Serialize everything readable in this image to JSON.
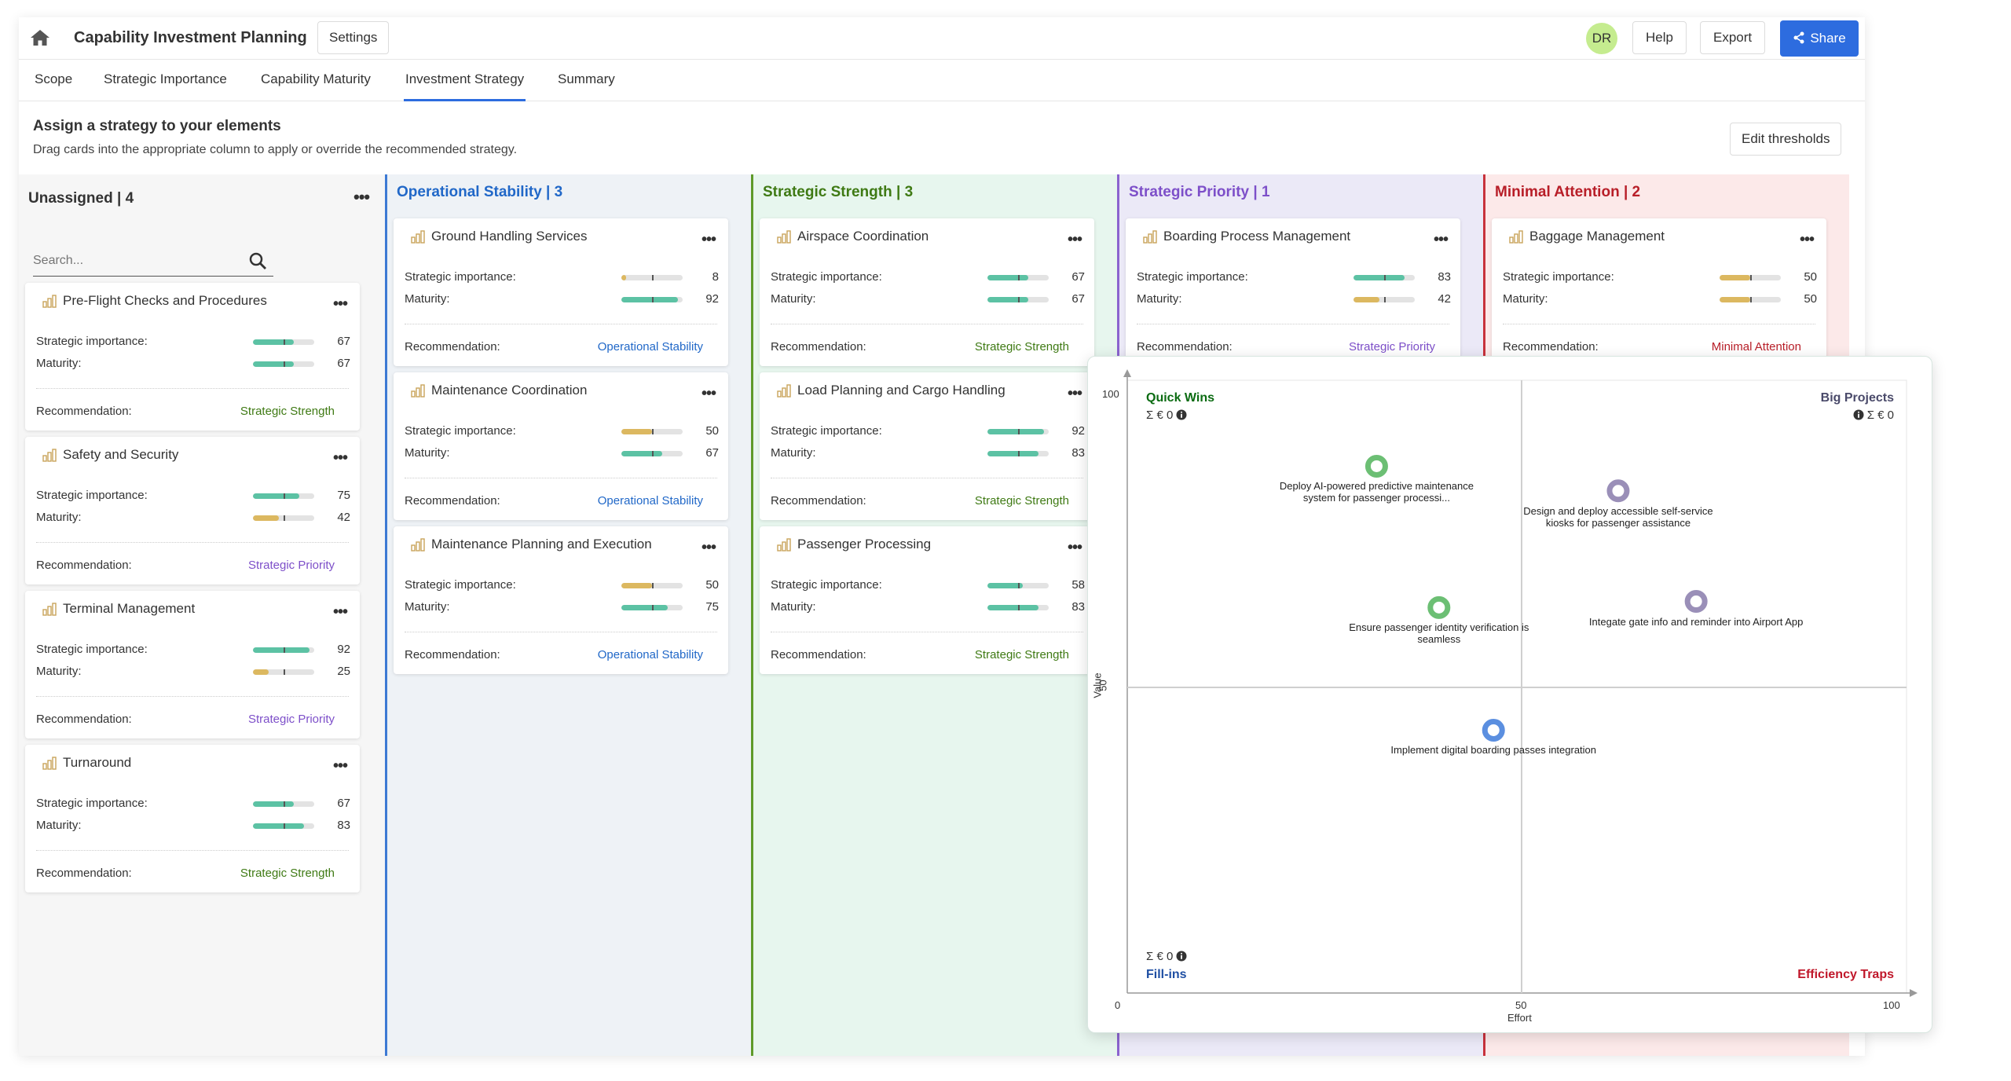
{
  "header": {
    "title": "Capability Investment Planning",
    "settings_label": "Settings",
    "avatar_initials": "DR",
    "help_label": "Help",
    "export_label": "Export",
    "share_label": "Share"
  },
  "tabs": [
    {
      "label": "Scope"
    },
    {
      "label": "Strategic Importance"
    },
    {
      "label": "Capability Maturity"
    },
    {
      "label": "Investment Strategy",
      "active": true
    },
    {
      "label": "Summary"
    }
  ],
  "intro": {
    "title": "Assign a strategy to your elements",
    "subtitle": "Drag cards into the appropriate column to apply or override the recommended strategy.",
    "edit_thresholds_label": "Edit thresholds"
  },
  "card_labels": {
    "importance": "Strategic importance:",
    "maturity": "Maturity:",
    "recommendation": "Recommendation:"
  },
  "colors": {
    "high": "#5cc2a4",
    "low": "#dcb860",
    "operational": "#2168c8",
    "strategic_strength": "#3f7a14",
    "strategic_priority": "#7d4fc9",
    "minimal_attention": "#b81e28"
  },
  "columns": {
    "unassigned": {
      "header": "Unassigned | 4",
      "search_placeholder": "Search...",
      "cards": [
        {
          "title": "Pre-Flight Checks and Procedures",
          "importance": 67,
          "maturity": 67,
          "recommendation": "Strategic Strength"
        },
        {
          "title": "Safety and Security",
          "importance": 75,
          "maturity": 42,
          "recommendation": "Strategic Priority"
        },
        {
          "title": "Terminal Management",
          "importance": 92,
          "maturity": 25,
          "recommendation": "Strategic Priority"
        },
        {
          "title": "Turnaround",
          "importance": 67,
          "maturity": 83,
          "recommendation": "Strategic Strength"
        }
      ]
    },
    "operational": {
      "header": "Operational Stability | 3",
      "cards": [
        {
          "title": "Ground Handling Services",
          "importance": 8,
          "maturity": 92,
          "recommendation": "Operational Stability"
        },
        {
          "title": "Maintenance Coordination",
          "importance": 50,
          "maturity": 67,
          "recommendation": "Operational Stability"
        },
        {
          "title": "Maintenance Planning and Execution",
          "importance": 50,
          "maturity": 75,
          "recommendation": "Operational Stability"
        }
      ]
    },
    "strategic_strength": {
      "header": "Strategic Strength | 3",
      "cards": [
        {
          "title": "Airspace Coordination",
          "importance": 67,
          "maturity": 67,
          "recommendation": "Strategic Strength"
        },
        {
          "title": "Load Planning and Cargo Handling",
          "importance": 92,
          "maturity": 83,
          "recommendation": "Strategic Strength"
        },
        {
          "title": "Passenger Processing",
          "importance": 58,
          "maturity": 83,
          "recommendation": "Strategic Strength"
        }
      ]
    },
    "strategic_priority": {
      "header": "Strategic Priority | 1",
      "cards": [
        {
          "title": "Boarding Process Management",
          "importance": 83,
          "maturity": 42,
          "recommendation": "Strategic Priority"
        }
      ]
    },
    "minimal_attention": {
      "header": "Minimal Attention | 2",
      "cards": [
        {
          "title": "Baggage Management",
          "importance": 50,
          "maturity": 50,
          "recommendation": "Minimal Attention"
        }
      ]
    }
  },
  "matrix": {
    "quadrants": {
      "quick_wins": "Quick Wins",
      "big_projects": "Big Projects",
      "fill_ins": "Fill-ins",
      "efficiency_traps": "Efficiency Traps",
      "quick_wins_sum": "Σ € 0",
      "big_projects_sum": "Σ € 0",
      "fill_ins_sum": "Σ € 0"
    },
    "colors": {
      "quick_wins": "#0b6b12",
      "big_projects": "#4a4a6a",
      "fill_ins": "#1f4fa3",
      "efficiency_traps": "#c0172a"
    }
  },
  "chart_data": {
    "type": "scatter",
    "xlabel": "Effort",
    "ylabel": "Value",
    "xlim": [
      0,
      100
    ],
    "ylim": [
      0,
      100
    ],
    "x_ticks": [
      "0",
      "50",
      "100"
    ],
    "y_ticks": [
      "50",
      "100"
    ],
    "points": [
      {
        "label": "Deploy AI-powered predictive maintenance system for passenger processi...",
        "x": 32,
        "y": 86,
        "color": "#6cbf74"
      },
      {
        "label": "Design and deploy accessible self-service kiosks for passenger assistance",
        "x": 63,
        "y": 82,
        "color": "#9a8fb8"
      },
      {
        "label": "Ensure passenger identity verification is seamless",
        "x": 40,
        "y": 63,
        "color": "#6cbf74"
      },
      {
        "label": "Integate gate info and reminder into Airport App",
        "x": 73,
        "y": 64,
        "color": "#9a8fb8"
      },
      {
        "label": "Implement digital boarding passes integration",
        "x": 47,
        "y": 43,
        "color": "#5b8fe0"
      }
    ]
  }
}
